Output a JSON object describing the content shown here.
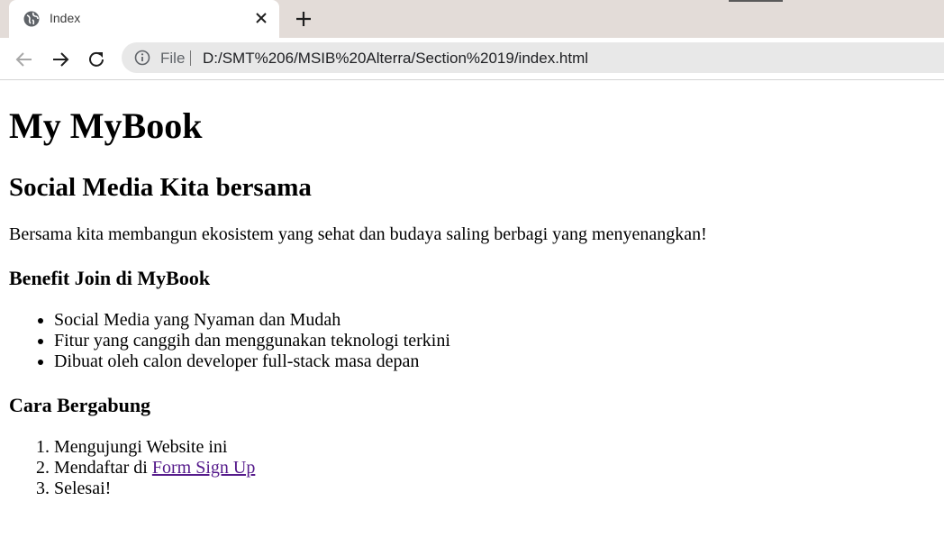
{
  "browser": {
    "tab_title": "Index",
    "address_scheme": "File",
    "address_url": "D:/SMT%206/MSIB%20Alterra/Section%2019/index.html"
  },
  "page": {
    "h1": "My MyBook",
    "h2": "Social Media Kita bersama",
    "intro": "Bersama kita membangun ekosistem yang sehat dan budaya saling berbagi yang menyenangkan!",
    "benefit_heading": "Benefit Join di MyBook",
    "benefits": [
      "Social Media yang Nyaman dan Mudah",
      "Fitur yang canggih dan menggunakan teknologi terkini",
      "Dibuat oleh calon developer full-stack masa depan"
    ],
    "join_heading": "Cara Bergabung",
    "steps": {
      "step1": "Mengujungi Website ini",
      "step2_prefix": "Mendaftar di ",
      "step2_link": "Form Sign Up",
      "step3": "Selesai!"
    }
  }
}
